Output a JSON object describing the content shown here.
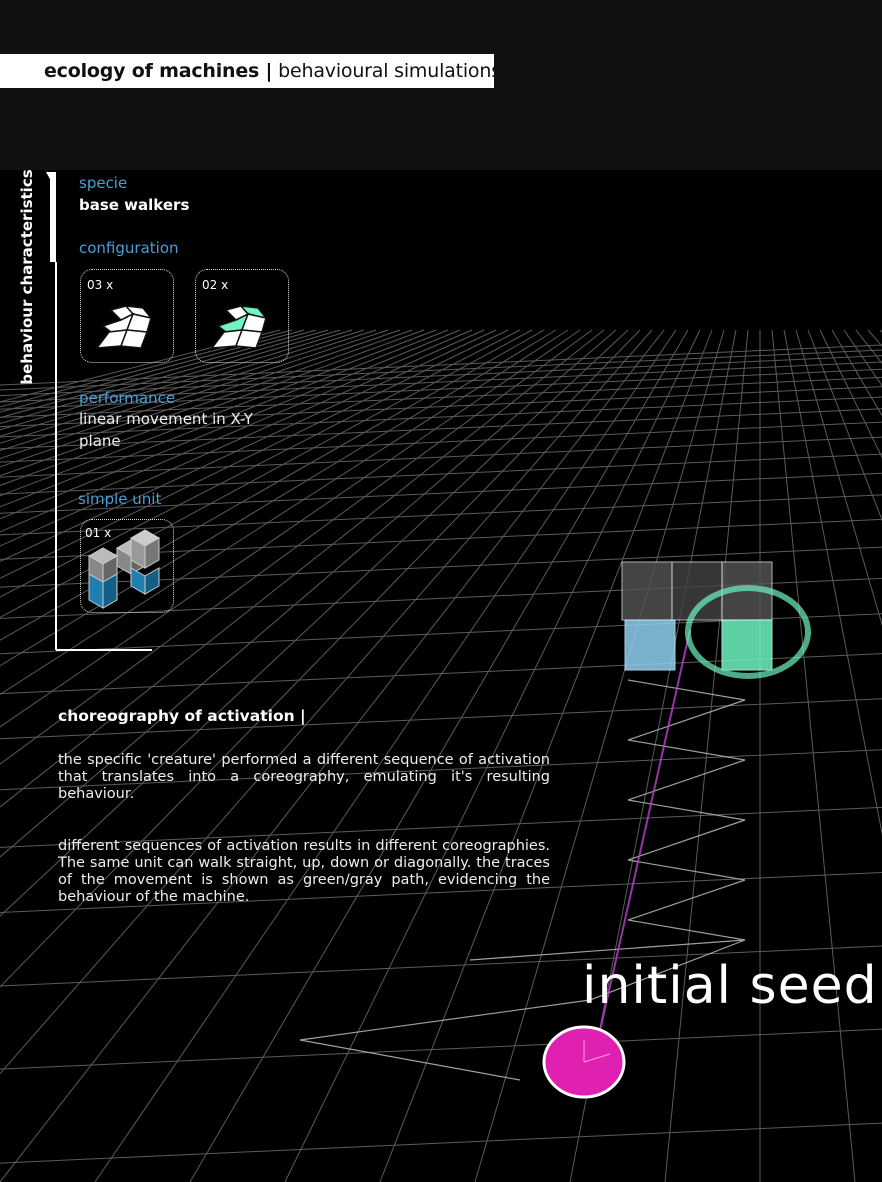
{
  "header": {
    "title_bold": "ecology of machines |",
    "title_light": " behavioural simulations"
  },
  "sidebar": {
    "vertical_label": "behaviour characteristics"
  },
  "specie": {
    "label": "specie",
    "value": "base walkers"
  },
  "configuration": {
    "label": "configuration",
    "items": [
      {
        "count": "03 x",
        "color": "#ffffff"
      },
      {
        "count": "02 x",
        "color": "#6ef5c0"
      }
    ]
  },
  "performance": {
    "label": "performance",
    "lines": [
      "linear movement in  X-Y",
      "plane"
    ]
  },
  "simple_unit": {
    "label": "simple unit",
    "count": "01 x"
  },
  "choreography": {
    "heading": "choreography of activation |",
    "paragraph1": "the specific 'creature' performed a different sequence of activation that translates into a coreography, emulating it's resulting behaviour.",
    "paragraph2": "different sequences of activation results in different coreographies. The same unit can walk straight, up, down or diagonally. the traces of the movement is shown as green/gray path, evidencing the behaviour of the machine."
  },
  "scene": {
    "seed_label": "initial seed"
  },
  "colors": {
    "accent_blue": "#4a9fd6",
    "accent_green": "#6ef5c0",
    "seed_magenta": "#e020b0"
  }
}
